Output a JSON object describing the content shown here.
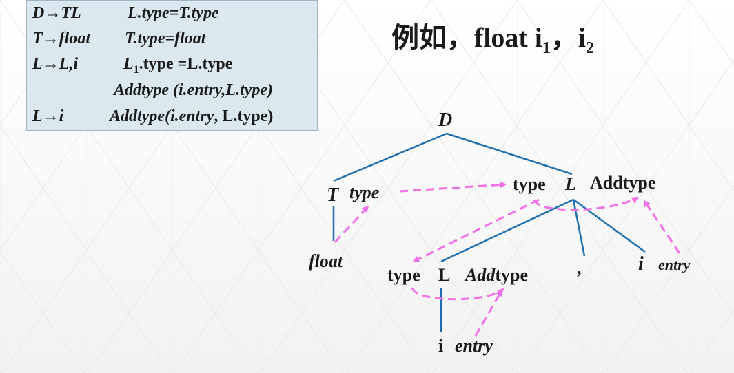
{
  "rules": [
    {
      "head": "D→TL",
      "action": "L.type=T.type"
    },
    {
      "head": "T→float",
      "action": "T.type=float"
    },
    {
      "head": "L→L,i",
      "action_pre": "L",
      "action_sub": "1",
      "action_post": ".type  =L.type"
    },
    {
      "head": "",
      "action_fn": "Addtype",
      "action_args": " (i.entry,L.type)"
    },
    {
      "head": "L→i",
      "action_fn": "Addtype",
      "action_args_a": "(i.entry",
      "action_args_b": ", L.type)"
    }
  ],
  "example": {
    "prefix": "例如，",
    "word": "float i",
    "sub1": "1",
    "comma": "，i",
    "sub2": "2"
  },
  "tree": {
    "root": "D",
    "t": "T",
    "t_attr": "type",
    "float": "float",
    "l_top_attr": "type",
    "l_top": "L",
    "l_top_action": "Addtype",
    "l_mid_attr": "type",
    "l_mid": "L",
    "l_mid_action_a": "Add",
    "l_mid_action_b": "type",
    "comma": ",",
    "i_right": "i",
    "i_right_attr": "entry",
    "i_bottom": "i",
    "i_bottom_attr": "entry"
  },
  "colors": {
    "edge": "#1f6fb0",
    "arrow": "#f070e8",
    "panel": "#dbe8f0"
  }
}
